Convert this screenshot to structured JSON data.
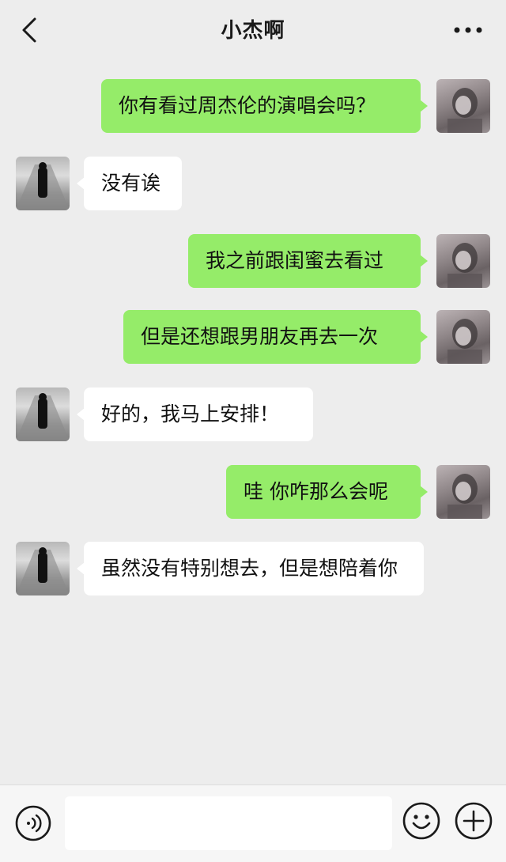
{
  "header": {
    "title": "小杰啊",
    "back_icon": "chevron-left-icon",
    "more_icon": "more-horizontal-icon"
  },
  "messages": [
    {
      "sender": "me",
      "text": "你有看过周杰伦的演唱会吗？"
    },
    {
      "sender": "friend",
      "text": "没有诶"
    },
    {
      "sender": "me",
      "text": "我之前跟闺蜜去看过"
    },
    {
      "sender": "me",
      "text": "但是还想跟男朋友再去一次"
    },
    {
      "sender": "friend",
      "text": "好的，我马上安排！"
    },
    {
      "sender": "me",
      "text": "哇 你咋那么会呢"
    },
    {
      "sender": "friend",
      "text": "虽然没有特别想去，但是想陪着你"
    }
  ],
  "footer": {
    "voice_icon": "voice-icon",
    "input_value": "",
    "emoji_icon": "emoji-icon",
    "plus_icon": "plus-icon"
  },
  "colors": {
    "sent_bubble": "#95ec69",
    "received_bubble": "#ffffff",
    "background": "#ededed"
  }
}
